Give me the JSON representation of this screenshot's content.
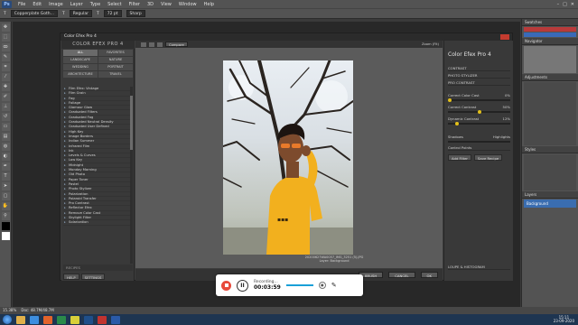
{
  "menubar": {
    "logo": "Ps",
    "items": [
      "File",
      "Edit",
      "Image",
      "Layer",
      "Type",
      "Select",
      "Filter",
      "3D",
      "View",
      "Window",
      "Help"
    ],
    "window_controls": [
      "–",
      "□",
      "✕"
    ]
  },
  "optbar": {
    "fields": [
      "Copperplate Goth...",
      "T",
      "Regular",
      "T",
      "72 pt",
      "Sharp"
    ]
  },
  "dialog": {
    "title": "Color Efex Pro 4",
    "brand": "COLOR EFEX PRO 4",
    "categories": [
      {
        "label": "ALL",
        "selected": true
      },
      {
        "label": "FAVORITES",
        "selected": false
      },
      {
        "label": "LANDSCAPE",
        "selected": false
      },
      {
        "label": "NATURE",
        "selected": false
      },
      {
        "label": "WEDDING",
        "selected": false
      },
      {
        "label": "PORTRAIT",
        "selected": false
      },
      {
        "label": "ARCHITECTURE",
        "selected": false
      },
      {
        "label": "TRAVEL",
        "selected": false
      }
    ],
    "filters": [
      "Film Efex: Vintage",
      "Film Grain",
      "Fog",
      "Foliage",
      "Glamour Glow",
      "Graduated Filters",
      "Graduated Fog",
      "Graduated Neutral Density",
      "Graduated User Defined",
      "High Key",
      "Image Borders",
      "Indian Summer",
      "Infrared Film",
      "Ink",
      "Levels & Curves",
      "Low Key",
      "Midnight",
      "Monday Morning",
      "Old Photo",
      "Paper Toner",
      "Pastel",
      "Photo Stylizer",
      "Polarization",
      "Polaroid Transfer",
      "Pro Contrast",
      "Reflector Efex",
      "Remove Color Cast",
      "Skylight Filter",
      "Solarization"
    ],
    "recipes_label": "RECIPES",
    "help_label": "HELP",
    "settings_label": "SETTINGS",
    "compare_label": "Compare",
    "zoom_label": "Zoom (Fit)",
    "photo_caption_1": "20200627WA0057_IMG_3251 (5).JPG",
    "photo_caption_2": "Layer: Background",
    "brush_label": "BRUSH",
    "cancel_label": "CANCEL",
    "ok_label": "OK",
    "right_title": "Color Efex Pro 4",
    "sections": [
      "CONTRAST",
      "PHOTO STYLIZER",
      "PRO CONTRAST"
    ],
    "sliders": [
      {
        "label": "Correct Color Cast",
        "value": "0%"
      },
      {
        "label": "Correct Contrast",
        "value": "50%"
      },
      {
        "label": "Dynamic Contrast",
        "value": "12%"
      }
    ],
    "shadows_label": "Shadows",
    "highlights_label": "Highlights",
    "control_points_label": "Control Points",
    "add_filter_label": "Add Filter",
    "save_recipe_label": "Save Recipe",
    "loupe_label": "LOUPE & HISTOGRAM"
  },
  "rightpanel": {
    "tabs": [
      "Swatches",
      "Navigator",
      "Layers",
      "Adjustments",
      "Styles"
    ],
    "layer_label": "Background"
  },
  "statusbar": {
    "zoom": "15.38%",
    "doc": "Doc: 48.7M/48.7M"
  },
  "recorder": {
    "status": "Recording...",
    "time": "00:03:59"
  },
  "taskbar": {
    "time": "15:11",
    "date": "23-09-2020"
  },
  "colors": {
    "accent_knob": "#e3c01a",
    "record_red": "#e84a3b",
    "shirt": "#f2b01e"
  }
}
